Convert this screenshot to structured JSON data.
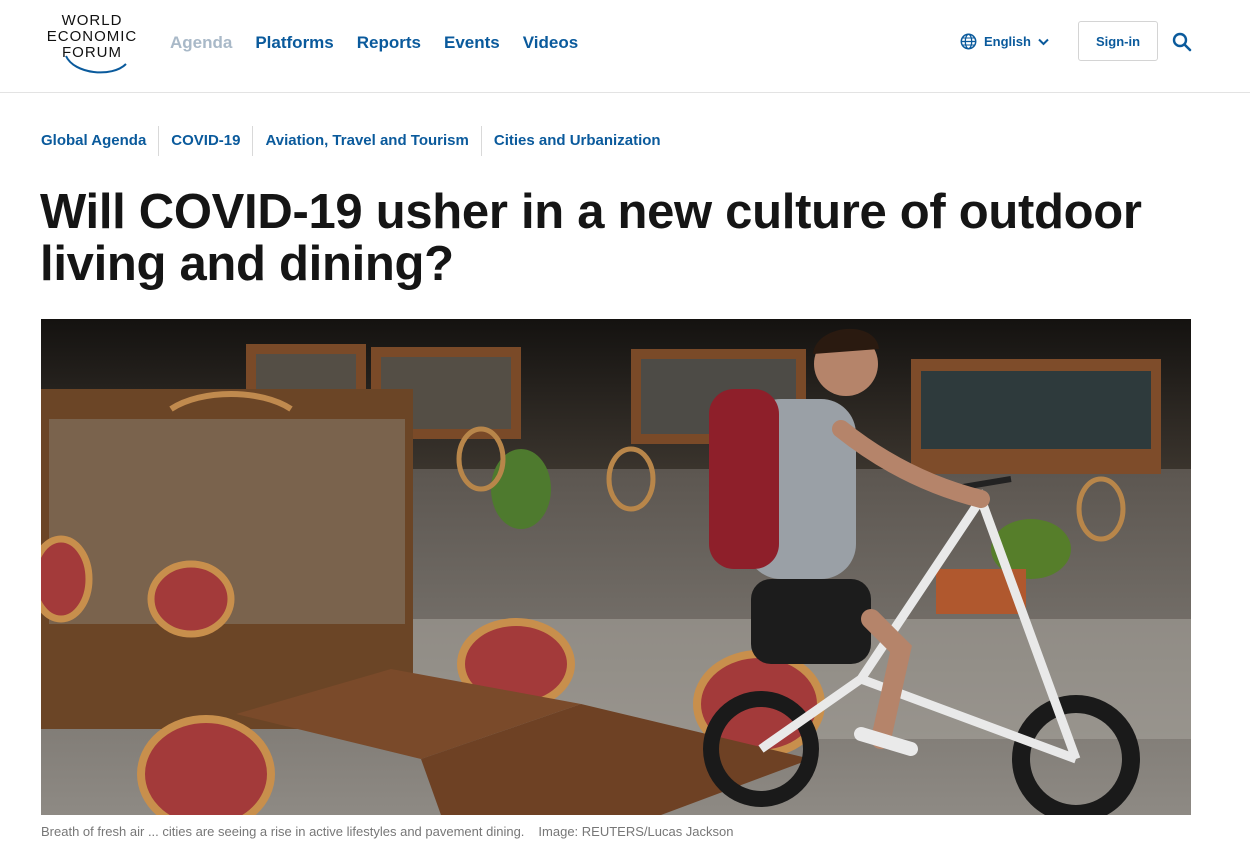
{
  "brand": {
    "logo_lines": [
      "WORLD",
      "ECONOMIC",
      "FORUM"
    ]
  },
  "nav": {
    "items": [
      {
        "label": "Agenda",
        "active": false
      },
      {
        "label": "Platforms"
      },
      {
        "label": "Reports"
      },
      {
        "label": "Events"
      },
      {
        "label": "Videos"
      }
    ]
  },
  "header": {
    "language": "English",
    "signin_label": "Sign-in",
    "icons": {
      "language": "globe-icon",
      "dropdown": "chevron-down-icon",
      "search": "search-icon"
    }
  },
  "article": {
    "topics": [
      "Global Agenda",
      "COVID-19",
      "Aviation, Travel and Tourism",
      "Cities and Urbanization"
    ],
    "title": "Will COVID-19 usher in a new culture of outdoor living and dining?",
    "image_caption": "Breath of fresh air ... cities are seeing a rise in active lifestyles and pavement dining.",
    "image_credit": "Image: REUTERS/Lucas Jackson"
  },
  "colors": {
    "link_blue": "#0a5a9c",
    "muted_nav": "#a9b9c8",
    "title_text": "#151515",
    "caption_text": "#777777"
  }
}
